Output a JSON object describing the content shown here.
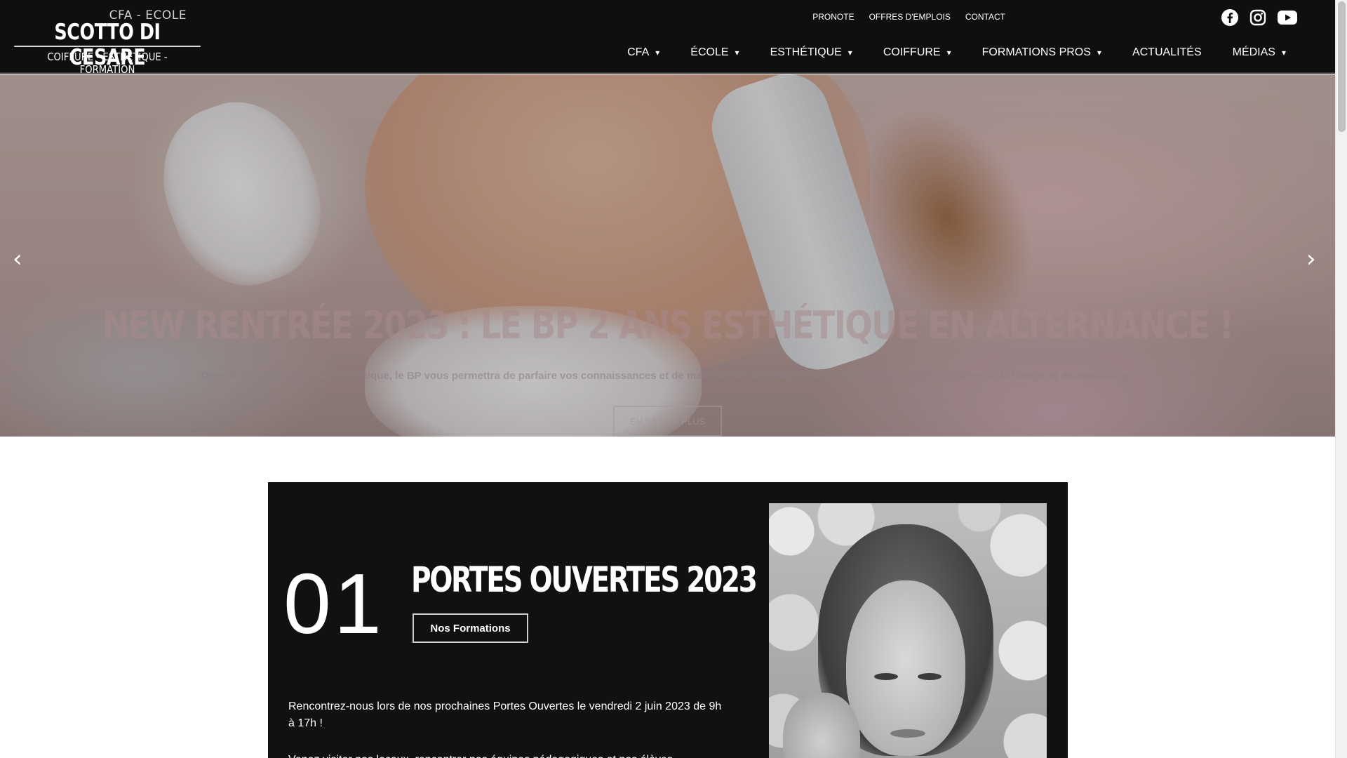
{
  "logo": {
    "top": "CFA - ECOLE",
    "main": "SCOTTO DI CESARE",
    "sub": "COIFFURE - ESTHETIQUE - FORMATION"
  },
  "topnav": [
    "PRONOTE",
    "OFFRES D'EMPLOIS",
    "CONTACT"
  ],
  "social": [
    "facebook-icon",
    "instagram-icon",
    "youtube-icon"
  ],
  "mainnav": {
    "items": [
      {
        "label": "CFA",
        "dropdown": "▾"
      },
      {
        "label": "ÉCOLE",
        "dropdown": "▾"
      },
      {
        "label": "ESTHÉTIQUE",
        "dropdown": "▾"
      },
      {
        "label": "COIFFURE",
        "dropdown": "▾"
      },
      {
        "label": "FORMATIONS PROS",
        "dropdown": "▾"
      },
      {
        "label": "ACTUALITÉS",
        "dropdown": ""
      },
      {
        "label": "MÉDIAS",
        "dropdown": "▾"
      }
    ]
  },
  "hero": {
    "title": "NEW RENTRÉE 2023 : LE BP 2 ANS ESTHÉTIQUE EN ALTERNANCE !",
    "text": "Dans la continuité du CAP Esthétique, le BP vous permettra de parfaire vos connaissances et de maîtriser les techniques de soins du corps, d'embellissement de l'ongle et de maquillage.",
    "button": "EN SAVOIR PLUS",
    "prev": "‹",
    "next": "›"
  },
  "section": {
    "number": "01",
    "title": "PORTES OUVERTES 2023",
    "button": "Nos Formations",
    "text": "Rencontrez-nous lors de nos prochaines Portes Ouvertes le vendredi 2 juin 2023 de 9h à 17h !",
    "text2": "Venez visiter nos locaux, rencontrer nos équipes pédagogiques et nos élèves."
  },
  "colors": {
    "header_bg": "#0f0f0f",
    "card_bg": "#111111",
    "text": "#ffffff"
  }
}
